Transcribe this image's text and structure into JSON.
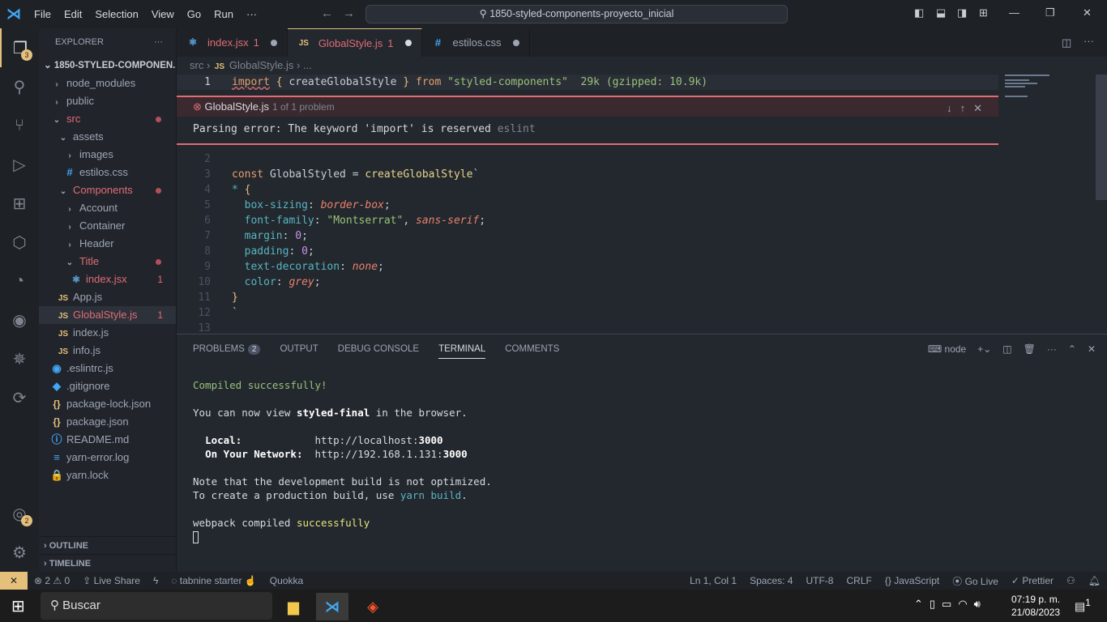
{
  "titlebar": {
    "menus": [
      "File",
      "Edit",
      "Selection",
      "View",
      "Go",
      "Run",
      "···"
    ],
    "command_center": "1850-styled-components-proyecto_inicial"
  },
  "activity": {
    "explorer_badge": "3",
    "accounts_badge": "2"
  },
  "sidebar": {
    "title": "EXPLORER",
    "more": "···",
    "root": "1850-STYLED-COMPONEN...",
    "items": [
      {
        "label": "node_modules",
        "depth": 1,
        "type": "folder",
        "chev": "›"
      },
      {
        "label": "public",
        "depth": 1,
        "type": "folder",
        "chev": "›"
      },
      {
        "label": "src",
        "depth": 1,
        "type": "folder",
        "chev": "⌄",
        "error": true,
        "dot": true
      },
      {
        "label": "assets",
        "depth": 2,
        "type": "folder",
        "chev": "⌄"
      },
      {
        "label": "images",
        "depth": 3,
        "type": "folder",
        "chev": "›"
      },
      {
        "label": "estilos.css",
        "depth": 3,
        "type": "css",
        "icon": "#"
      },
      {
        "label": "Components",
        "depth": 2,
        "type": "folder",
        "chev": "⌄",
        "error": true,
        "dot": true
      },
      {
        "label": "Account",
        "depth": 3,
        "type": "folder",
        "chev": "›"
      },
      {
        "label": "Container",
        "depth": 3,
        "type": "folder",
        "chev": "›"
      },
      {
        "label": "Header",
        "depth": 3,
        "type": "folder",
        "chev": "›"
      },
      {
        "label": "Title",
        "depth": 3,
        "type": "folder",
        "chev": "⌄",
        "error": true,
        "dot": true
      },
      {
        "label": "index.jsx",
        "depth": 4,
        "type": "react",
        "icon": "⚛",
        "error": true,
        "count": "1"
      },
      {
        "label": "App.js",
        "depth": 2,
        "type": "js",
        "icon": "JS"
      },
      {
        "label": "GlobalStyle.js",
        "depth": 2,
        "type": "js",
        "icon": "JS",
        "error": true,
        "count": "1",
        "selected": true
      },
      {
        "label": "index.js",
        "depth": 2,
        "type": "js",
        "icon": "JS"
      },
      {
        "label": "info.js",
        "depth": 2,
        "type": "js",
        "icon": "JS"
      },
      {
        "label": ".eslintrc.js",
        "depth": 1,
        "type": "css",
        "icon": "◉"
      },
      {
        "label": ".gitignore",
        "depth": 1,
        "type": "css",
        "icon": "◆"
      },
      {
        "label": "package-lock.json",
        "depth": 1,
        "type": "json",
        "icon": "{}"
      },
      {
        "label": "package.json",
        "depth": 1,
        "type": "json",
        "icon": "{}"
      },
      {
        "label": "README.md",
        "depth": 1,
        "type": "css",
        "icon": "ⓘ"
      },
      {
        "label": "yarn-error.log",
        "depth": 1,
        "type": "css",
        "icon": "≡"
      },
      {
        "label": "yarn.lock",
        "depth": 1,
        "type": "css",
        "icon": "🔒"
      }
    ],
    "outline": "OUTLINE",
    "timeline": "TIMELINE"
  },
  "tabs": [
    {
      "icon": "⚛",
      "label": "index.jsx",
      "count": "1"
    },
    {
      "icon": "JS",
      "label": "GlobalStyle.js",
      "count": "1",
      "active": true
    },
    {
      "icon": "#",
      "label": "estilos.css",
      "count": ""
    }
  ],
  "breadcrumb": {
    "src": "src",
    "file": "GlobalStyle.js",
    "more": "..."
  },
  "peek": {
    "file": "GlobalStyle.js",
    "count": "1 of 1 problem",
    "message": "Parsing error: The keyword 'import' is reserved",
    "source": "eslint"
  },
  "code": {
    "import_hint": "29k (gzipped: 10.9k)"
  },
  "panel": {
    "tabs": [
      "PROBLEMS",
      "OUTPUT",
      "DEBUG CONSOLE",
      "TERMINAL",
      "COMMENTS"
    ],
    "problems_count": "2",
    "terminal_name": "node",
    "terminal": {
      "l1": "Compiled successfully!",
      "l2a": "You can now view ",
      "l2b": "styled-final",
      "l2c": " in the browser.",
      "local_label": "Local:",
      "local_url": "http://localhost:",
      "port": "3000",
      "net_label": "On Your Network:",
      "net_url": "http://192.168.1.131:",
      "l4": "Note that the development build is not optimized.",
      "l5a": "To create a production build, use ",
      "l5b": "yarn build",
      "l5c": ".",
      "l6a": "webpack compiled ",
      "l6b": "successfully"
    }
  },
  "statusbar": {
    "problems": "⊗ 2 ⚠ 0",
    "liveshare": "Live Share",
    "tabnine": "tabnine starter",
    "quokka": "Quokka",
    "position": "Ln 1, Col 1",
    "spaces": "Spaces: 4",
    "encoding": "UTF-8",
    "eol": "CRLF",
    "language": "JavaScript",
    "golive": "Go Live",
    "prettier": "Prettier"
  },
  "taskbar": {
    "search": "Buscar",
    "time": "07:19 p. m.",
    "date": "21/08/2023",
    "notif": "1"
  }
}
